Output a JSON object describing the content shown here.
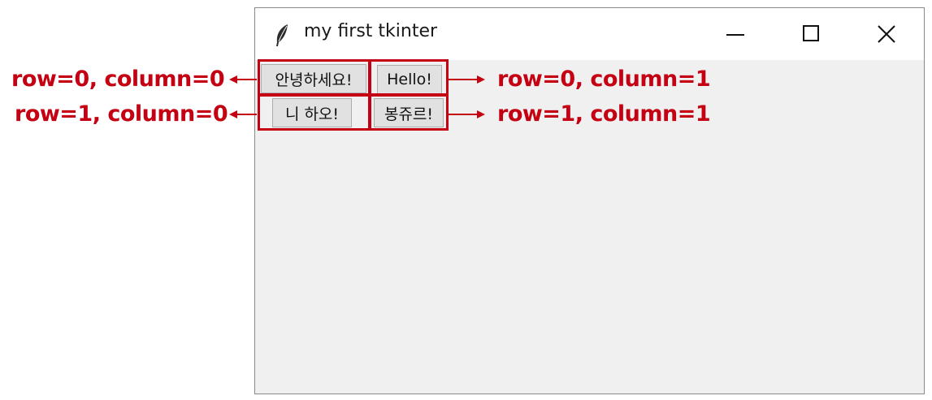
{
  "window": {
    "title": "my first tkinter",
    "controls": {
      "minimize_icon": "minimize-icon",
      "maximize_icon": "maximize-icon",
      "close_icon": "close-icon"
    }
  },
  "grid_buttons": [
    {
      "label": "안녕하세요!",
      "annotation": "row=0, column=0"
    },
    {
      "label": "Hello!",
      "annotation": "row=0, column=1"
    },
    {
      "label": "니 하오!",
      "annotation": "row=1, column=0"
    },
    {
      "label": "봉쥬르!",
      "annotation": "row=1, column=1"
    }
  ],
  "colors": {
    "annotation": "#c40012",
    "window_background": "#f0f0f0",
    "titlebar_background": "#ffffff"
  }
}
